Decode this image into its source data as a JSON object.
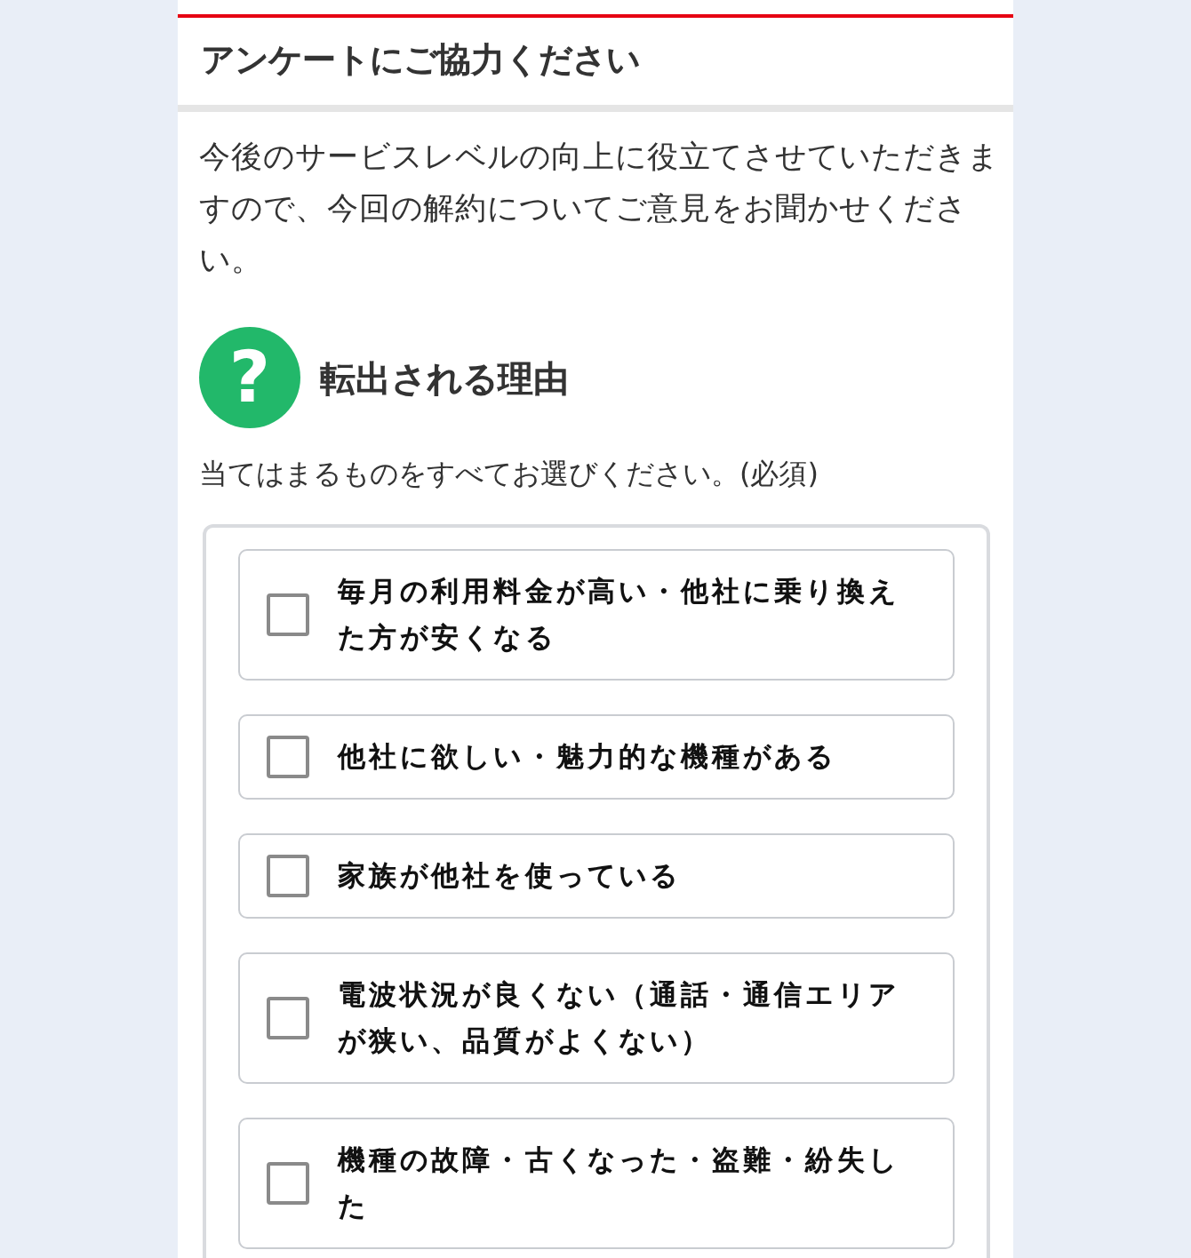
{
  "header": {
    "title": "アンケートにご協力ください"
  },
  "intro": "今後のサービスレベルの向上に役立てさせていただきますので、今回の解約についてご意見をお聞かせください。",
  "question": {
    "icon": "?",
    "title": "転出される理由",
    "instruction": "当てはまるものをすべてお選びください。(必須)",
    "options": [
      {
        "label": "毎月の利用料金が高い・他社に乗り換えた方が安くなる",
        "checked": false
      },
      {
        "label": "他社に欲しい・魅力的な機種がある",
        "checked": false
      },
      {
        "label": "家族が他社を使っている",
        "checked": false
      },
      {
        "label": "電波状況が良くない（通話・通信エリアが狭い、品質がよくない）",
        "checked": false
      },
      {
        "label": "機種の故障・古くなった・盗難・紛失した",
        "checked": false
      }
    ]
  }
}
